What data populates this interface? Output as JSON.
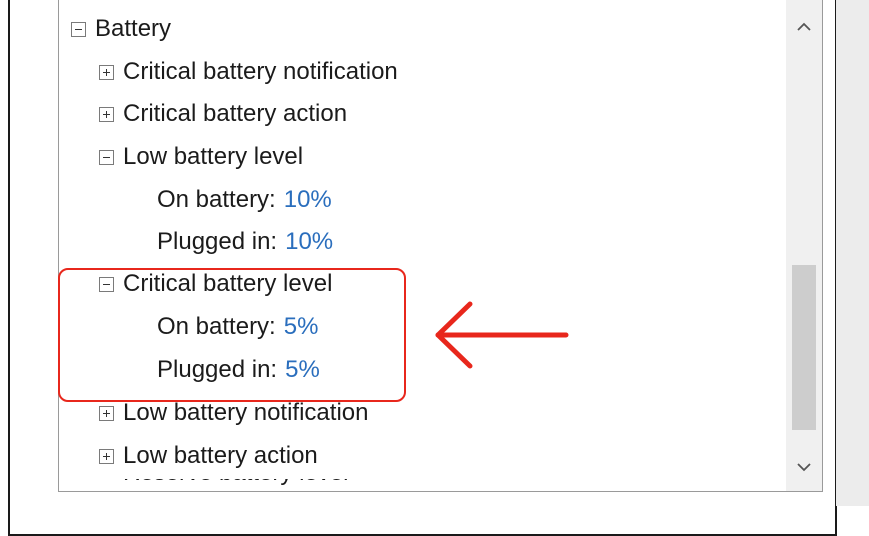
{
  "tree": {
    "battery": "Battery",
    "critical_battery_notification": "Critical battery notification",
    "critical_battery_action": "Critical battery action",
    "low_battery_level": {
      "label": "Low battery level",
      "on_battery_label": "On battery:",
      "on_battery_value": "10%",
      "plugged_in_label": "Plugged in:",
      "plugged_in_value": "10%"
    },
    "critical_battery_level": {
      "label": "Critical battery level",
      "on_battery_label": "On battery:",
      "on_battery_value": "5%",
      "plugged_in_label": "Plugged in:",
      "plugged_in_value": "5%"
    },
    "low_battery_notification": "Low battery notification",
    "low_battery_action": "Low battery action",
    "partial_next_item": "Reserve battery level"
  },
  "colors": {
    "value_text": "#2a6ebd",
    "annotation": "#e8271c"
  },
  "icons": {
    "expander_collapsed": "plus-box-icon",
    "expander_expanded": "minus-box-icon",
    "scroll_up": "chevron-up-icon",
    "scroll_down": "chevron-down-icon",
    "annotation_arrow": "left-arrow-icon"
  }
}
